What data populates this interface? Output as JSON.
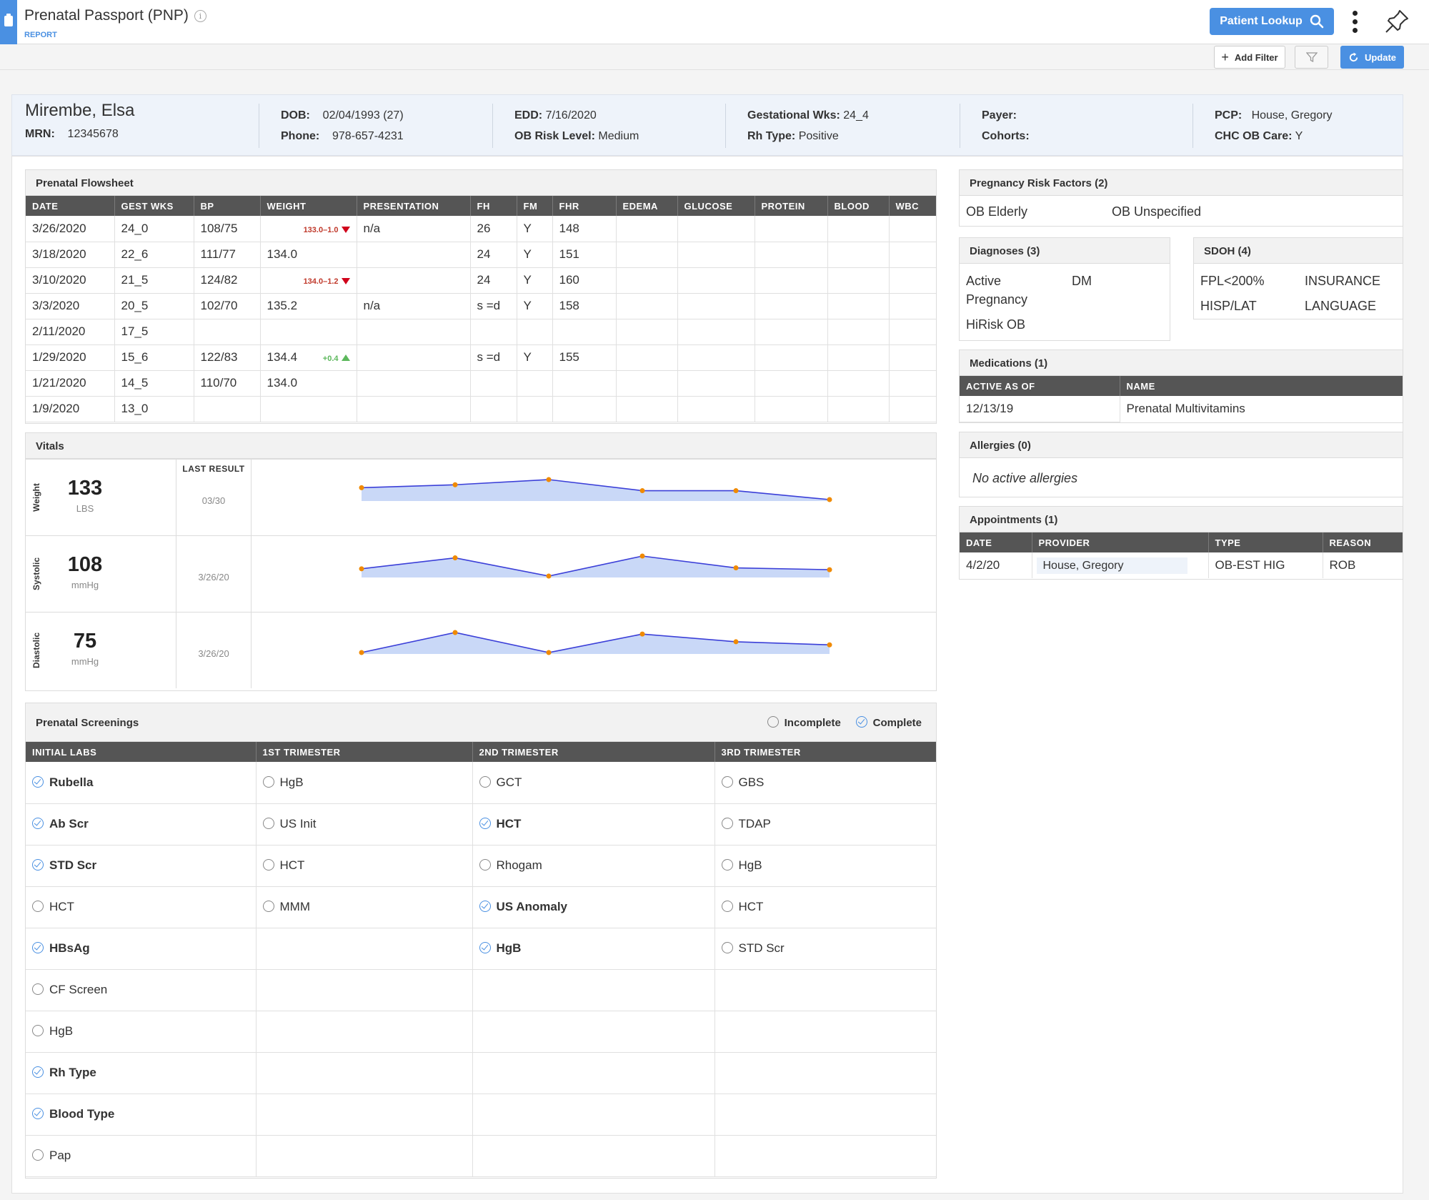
{
  "app": {
    "title": "Prenatal Passport (PNP)",
    "subtitle": "REPORT",
    "patient_lookup": "Patient Lookup",
    "add_filter": "Add Filter",
    "update": "Update",
    "accent": "#4a90e2"
  },
  "patient": {
    "name": "Mirembe, Elsa",
    "mrn_label": "MRN:",
    "mrn": "12345678",
    "dob_label": "DOB:",
    "dob": "02/04/1993 (27)",
    "phone_label": "Phone:",
    "phone": "978-657-4231",
    "edd_label": "EDD:",
    "edd": "7/16/2020",
    "risk_label": "OB Risk Level:",
    "risk": "Medium",
    "gest_label": "Gestational Wks:",
    "gest": "24_4",
    "rh_label": "Rh Type:",
    "rh": "Positive",
    "payer_label": "Payer:",
    "cohorts_label": "Cohorts:",
    "pcp_label": "PCP:",
    "pcp": "House, Gregory",
    "chc_label": "CHC OB Care:",
    "chc": "Y"
  },
  "flowsheet": {
    "title": "Prenatal Flowsheet",
    "columns": [
      "DATE",
      "GEST WKS",
      "BP",
      "WEIGHT",
      "PRESENTATION",
      "FH",
      "FM",
      "FHR",
      "EDEMA",
      "GLUCOSE",
      "PROTEIN",
      "BLOOD",
      "WBC"
    ],
    "rows": [
      {
        "date": "3/26/2020",
        "gest": "24_0",
        "bp": "108/75",
        "weight": "",
        "change": "133.0–1.0",
        "dir": "down",
        "pres": "n/a",
        "fh": "26",
        "fm": "Y",
        "fhr": "148"
      },
      {
        "date": "3/18/2020",
        "gest": "22_6",
        "bp": "111/77",
        "weight": "134.0",
        "change": "",
        "dir": "",
        "pres": "",
        "fh": "24",
        "fm": "Y",
        "fhr": "151"
      },
      {
        "date": "3/10/2020",
        "gest": "21_5",
        "bp": "124/82",
        "weight": "",
        "change": "134.0–1.2",
        "dir": "down",
        "pres": "",
        "fh": "24",
        "fm": "Y",
        "fhr": "160"
      },
      {
        "date": "3/3/2020",
        "gest": "20_5",
        "bp": "102/70",
        "weight": "135.2",
        "change": "",
        "dir": "",
        "pres": "n/a",
        "fh": "s =d",
        "fm": "Y",
        "fhr": "158"
      },
      {
        "date": "2/11/2020",
        "gest": "17_5",
        "bp": "",
        "weight": "",
        "change": "",
        "dir": "",
        "pres": "",
        "fh": "",
        "fm": "",
        "fhr": ""
      },
      {
        "date": "1/29/2020",
        "gest": "15_6",
        "bp": "122/83",
        "weight": "134.4",
        "change": "+0.4",
        "dir": "up",
        "pres": "",
        "fh": "s =d",
        "fm": "Y",
        "fhr": "155"
      },
      {
        "date": "1/21/2020",
        "gest": "14_5",
        "bp": "110/70",
        "weight": "134.0",
        "change": "",
        "dir": "",
        "pres": "",
        "fh": "",
        "fm": "",
        "fhr": ""
      },
      {
        "date": "1/9/2020",
        "gest": "13_0",
        "bp": "",
        "weight": "",
        "change": "",
        "dir": "",
        "pres": "",
        "fh": "",
        "fm": "",
        "fhr": ""
      }
    ]
  },
  "vitals": {
    "title": "Vitals",
    "last_result": "LAST RESULT",
    "items": [
      {
        "label": "Weight",
        "value": "133",
        "unit": "LBS",
        "date": "03/30",
        "series": [
          135.2,
          135.6,
          136.3,
          134.8,
          134.8,
          133.6
        ]
      },
      {
        "label": "Systolic",
        "value": "108",
        "unit": "mmHg",
        "date": "3/26/20",
        "series": [
          110,
          122,
          102,
          124,
          111,
          109
        ]
      },
      {
        "label": "Diastolic",
        "value": "75",
        "unit": "mmHg",
        "date": "3/26/20",
        "series": [
          70,
          83,
          70,
          82,
          77,
          75
        ]
      }
    ]
  },
  "screenings": {
    "title": "Prenatal Screenings",
    "legend_incomplete": "Incomplete",
    "legend_complete": "Complete",
    "columns": [
      "INITIAL LABS",
      "1ST TRIMESTER",
      "2ND TRIMESTER",
      "3RD TRIMESTER"
    ],
    "rows": [
      [
        {
          "t": "Rubella",
          "c": true
        },
        {
          "t": "HgB",
          "c": false
        },
        {
          "t": "GCT",
          "c": false
        },
        {
          "t": "GBS",
          "c": false
        }
      ],
      [
        {
          "t": "Ab Scr",
          "c": true
        },
        {
          "t": "US Init",
          "c": false
        },
        {
          "t": "HCT",
          "c": true
        },
        {
          "t": "TDAP",
          "c": false
        }
      ],
      [
        {
          "t": "STD Scr",
          "c": true
        },
        {
          "t": "HCT",
          "c": false
        },
        {
          "t": "Rhogam",
          "c": false
        },
        {
          "t": "HgB",
          "c": false
        }
      ],
      [
        {
          "t": "HCT",
          "c": false
        },
        {
          "t": "MMM",
          "c": false
        },
        {
          "t": "US Anomaly",
          "c": true
        },
        {
          "t": "HCT",
          "c": false
        }
      ],
      [
        {
          "t": "HBsAg",
          "c": true
        },
        null,
        {
          "t": "HgB",
          "c": true
        },
        {
          "t": "STD Scr",
          "c": false
        }
      ],
      [
        {
          "t": "CF Screen",
          "c": false
        },
        null,
        null,
        null
      ],
      [
        {
          "t": "HgB",
          "c": false
        },
        null,
        null,
        null
      ],
      [
        {
          "t": "Rh Type",
          "c": true
        },
        null,
        null,
        null
      ],
      [
        {
          "t": "Blood Type",
          "c": true
        },
        null,
        null,
        null
      ],
      [
        {
          "t": "Pap",
          "c": false
        },
        null,
        null,
        null
      ]
    ]
  },
  "risk_factors": {
    "title": "Pregnancy Risk Factors (2)",
    "items": [
      "OB Elderly",
      "OB Unspecified"
    ]
  },
  "diagnoses": {
    "title": "Diagnoses (3)",
    "items": [
      "Active Pregnancy",
      "DM",
      "HiRisk OB"
    ]
  },
  "sdoh": {
    "title": "SDOH (4)",
    "items": [
      "FPL<200%",
      "INSURANCE",
      "HISP/LAT",
      "LANGUAGE"
    ]
  },
  "medications": {
    "title": "Medications (1)",
    "columns": [
      "ACTIVE AS OF",
      "NAME"
    ],
    "rows": [
      [
        "12/13/19",
        "Prenatal Multivitamins"
      ]
    ]
  },
  "allergies": {
    "title": "Allergies (0)",
    "empty": "No active allergies"
  },
  "appointments": {
    "title": "Appointments (1)",
    "columns": [
      "DATE",
      "PROVIDER",
      "TYPE",
      "REASON"
    ],
    "rows": [
      [
        "4/2/20",
        "House, Gregory",
        "OB-EST HIG",
        "ROB"
      ]
    ]
  }
}
